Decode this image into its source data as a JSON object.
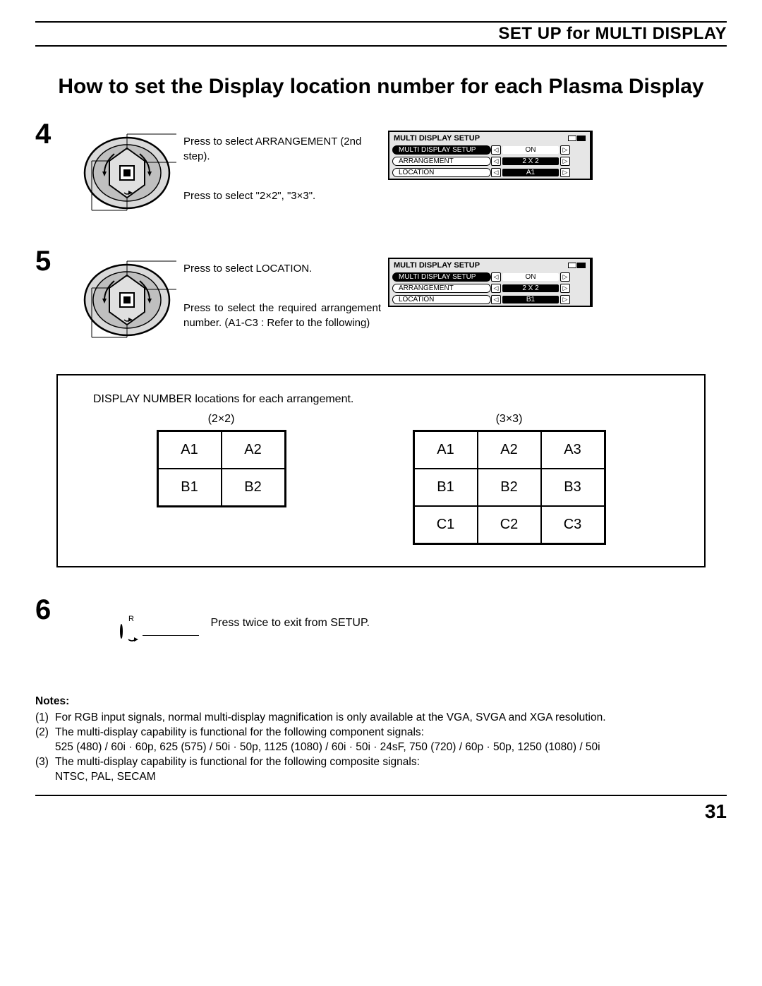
{
  "header": {
    "section": "SET UP for MULTI DISPLAY"
  },
  "title": "How to set the Display location number for each Plasma Display",
  "steps": {
    "s4": {
      "num": "4",
      "line1": "Press to select ARRANGEMENT (2nd step).",
      "line2": "Press to select \"2×2\", \"3×3\"."
    },
    "s5": {
      "num": "5",
      "line1": "Press to select LOCATION.",
      "line2": "Press to select the required arrangement number. (A1-C3 : Refer to the following)"
    },
    "s6": {
      "num": "6",
      "r_label": "R",
      "line1": "Press twice to exit from SETUP."
    }
  },
  "osd1": {
    "title": "MULTI DISPLAY SETUP",
    "rows": [
      {
        "label": "MULTI DISPLAY SETUP",
        "value": "ON",
        "selected": true
      },
      {
        "label": "ARRANGEMENT",
        "value": "2 X 2",
        "selected": false
      },
      {
        "label": "LOCATION",
        "value": "A1",
        "selected": false
      }
    ]
  },
  "osd2": {
    "title": "MULTI DISPLAY SETUP",
    "rows": [
      {
        "label": "MULTI DISPLAY SETUP",
        "value": "ON",
        "selected": true
      },
      {
        "label": "ARRANGEMENT",
        "value": "2 X 2",
        "selected": false
      },
      {
        "label": "LOCATION",
        "value": "B1",
        "selected": false
      }
    ]
  },
  "diagram": {
    "caption": "DISPLAY NUMBER locations for each arrangement.",
    "g2_label": "(2×2)",
    "g3_label": "(3×3)",
    "grid2": [
      [
        "A1",
        "A2"
      ],
      [
        "B1",
        "B2"
      ]
    ],
    "grid3": [
      [
        "A1",
        "A2",
        "A3"
      ],
      [
        "B1",
        "B2",
        "B3"
      ],
      [
        "C1",
        "C2",
        "C3"
      ]
    ]
  },
  "notes": {
    "title": "Notes:",
    "n1_num": "(1)",
    "n1": "For RGB input signals, normal multi-display magnification is only available at the VGA, SVGA and XGA resolution.",
    "n2_num": "(2)",
    "n2": "The multi-display capability is functional for the following component signals:",
    "n2b": "525 (480) / 60i · 60p, 625 (575) / 50i · 50p, 1125 (1080) / 60i · 50i · 24sF, 750 (720) / 60p · 50p, 1250 (1080) / 50i",
    "n3_num": "(3)",
    "n3": "The multi-display capability is functional for the following composite signals:",
    "n3b": "NTSC, PAL, SECAM"
  },
  "page_number": "31"
}
